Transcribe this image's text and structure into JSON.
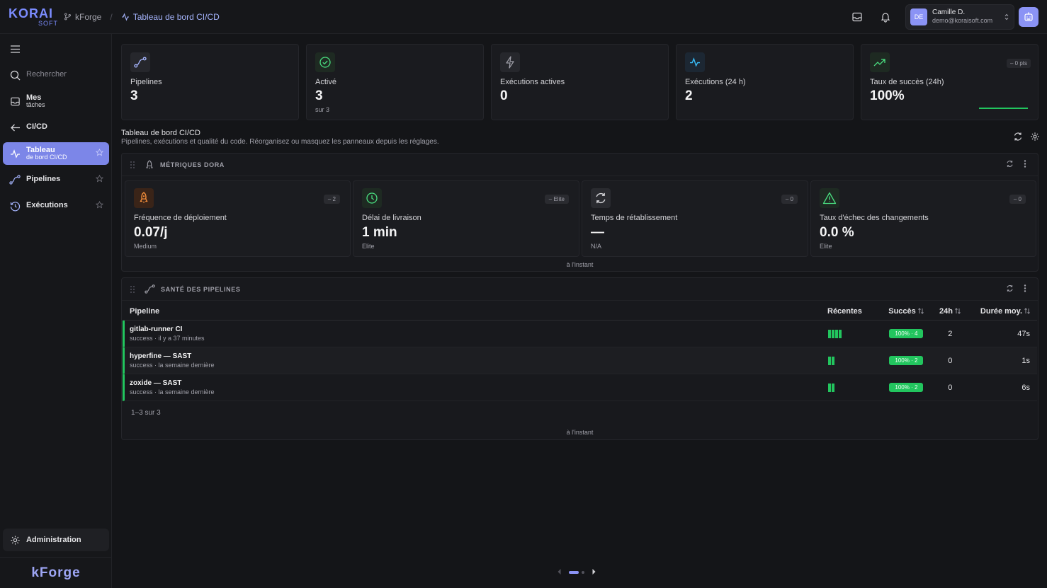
{
  "brand": {
    "logo_top": "KORAI",
    "logo_bottom": "SOFT",
    "footer": "kForge"
  },
  "breadcrumb": {
    "root": "kForge",
    "current": "Tableau de bord CI/CD"
  },
  "user": {
    "initials": "DE",
    "name": "Camille D.",
    "email": "demo@koraisoft.com"
  },
  "sidebar": {
    "search": "Rechercher",
    "tasks": {
      "label": "Mes",
      "sub": "tâches"
    },
    "cicd": "CI/CD",
    "dashboard": {
      "label": "Tableau",
      "sub": "de bord CI/CD"
    },
    "pipelines": "Pipelines",
    "executions": "Exécutions",
    "admin": "Administration"
  },
  "kpis": [
    {
      "label": "Pipelines",
      "value": "3",
      "sub": ""
    },
    {
      "label": "Activé",
      "value": "3",
      "sub": "sur 3"
    },
    {
      "label": "Exécutions actives",
      "value": "0",
      "sub": ""
    },
    {
      "label": "Exécutions (24 h)",
      "value": "2",
      "sub": ""
    },
    {
      "label": "Taux de succès (24h)",
      "value": "100%",
      "badge": "– 0 pts"
    }
  ],
  "section": {
    "title": "Tableau de bord CI/CD",
    "desc": "Pipelines, exécutions et qualité du code. Réorganisez ou masquez les panneaux depuis les réglages."
  },
  "dora": {
    "title": "MÉTRIQUES DORA",
    "footer": "à l'instant",
    "cards": [
      {
        "label": "Fréquence de déploiement",
        "value": "0.07/j",
        "sub": "Medium",
        "badge": "– 2"
      },
      {
        "label": "Délai de livraison",
        "value": "1 min",
        "sub": "Elite",
        "badge": "– Elite"
      },
      {
        "label": "Temps de rétablissement",
        "value": "—",
        "sub": "N/A",
        "badge": "– 0"
      },
      {
        "label": "Taux d'échec des changements",
        "value": "0.0 %",
        "sub": "Elite",
        "badge": "– 0"
      }
    ]
  },
  "health": {
    "title": "SANTÉ DES PIPELINES",
    "footer": "à l'instant",
    "columns": {
      "pipeline": "Pipeline",
      "recent": "Récentes",
      "success": "Succès",
      "h24": "24h",
      "duration": "Durée moy."
    },
    "rows": [
      {
        "name": "gitlab-runner CI",
        "sub": "success · il y a 37 minutes",
        "recent": 4,
        "success": "100% · 4",
        "h24": "2",
        "duration": "47s"
      },
      {
        "name": "hyperfine — SAST",
        "sub": "success · la semaine dernière",
        "recent": 2,
        "success": "100% · 2",
        "h24": "0",
        "duration": "1s"
      },
      {
        "name": "zoxide — SAST",
        "sub": "success · la semaine dernière",
        "recent": 2,
        "success": "100% · 2",
        "h24": "0",
        "duration": "6s"
      }
    ],
    "count": "1–3 sur 3"
  },
  "colors": {
    "accent": "#7c86e8",
    "success": "#22c55e",
    "background": "#141518"
  }
}
